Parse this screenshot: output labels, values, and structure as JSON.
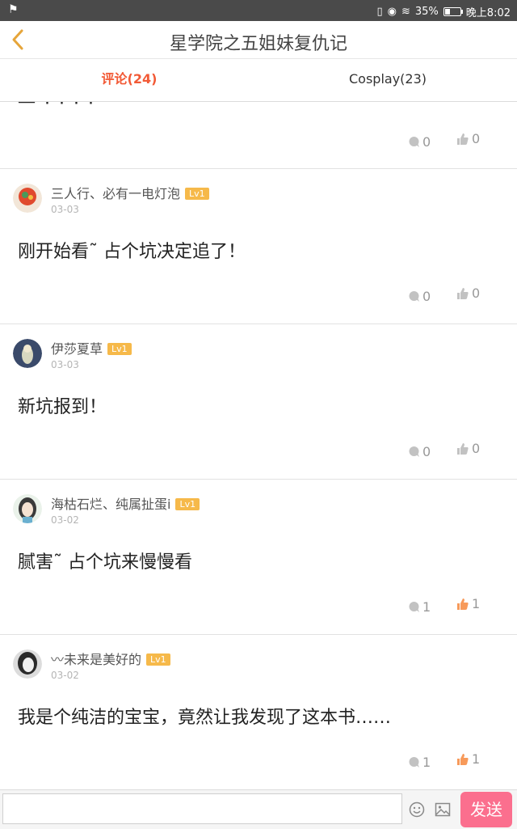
{
  "status_bar": {
    "battery": "35%",
    "time": "晚上8:02"
  },
  "header": {
    "title": "星学院之五姐妹复仇记"
  },
  "tabs": [
    {
      "label": "评论(24)",
      "active": true
    },
    {
      "label": "Cosplay(23)",
      "active": false
    }
  ],
  "first_card": {
    "reply_count": "0",
    "like_count": "0"
  },
  "comments": [
    {
      "username": "三人行、必有一电灯泡",
      "level": "Lv1",
      "date": "03-03",
      "content": "刚开始看˜ 占个坑决定追了！",
      "reply_count": "0",
      "like_count": "0",
      "liked": false
    },
    {
      "username": "伊莎夏草",
      "level": "Lv1",
      "date": "03-03",
      "content": "新坑报到！",
      "reply_count": "0",
      "like_count": "0",
      "liked": false
    },
    {
      "username": "海枯石烂、纯属扯蛋i",
      "level": "Lv1",
      "date": "03-02",
      "content": "腻害˜ 占个坑来慢慢看",
      "reply_count": "1",
      "like_count": "1",
      "liked": true
    },
    {
      "username": "〰未来是美好的",
      "level": "Lv1",
      "date": "03-02",
      "content": "我是个纯洁的宝宝，竟然让我发现了这本书……",
      "reply_count": "1",
      "like_count": "1",
      "liked": true
    }
  ],
  "composer": {
    "placeholder": "",
    "send_label": "发送"
  },
  "colors": {
    "accent": "#f25a36",
    "badge": "#f6b94a",
    "send": "#fb6f8e",
    "liked": "#f79a5a"
  }
}
